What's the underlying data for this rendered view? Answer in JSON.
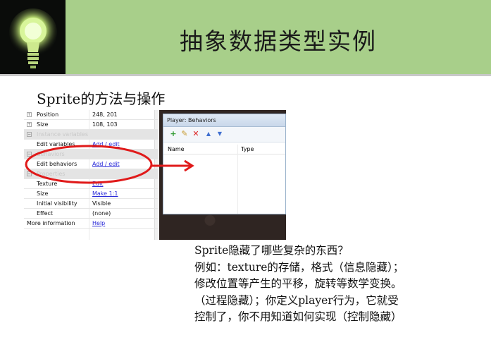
{
  "slide": {
    "title": "抽象数据类型实例",
    "subtitle": "Sprite的方法与操作"
  },
  "properties_panel": {
    "rows": [
      {
        "name": "Position",
        "value": "248, 201",
        "expander": "+"
      },
      {
        "name": "Size",
        "value": "108, 103",
        "expander": "+"
      },
      {
        "name": "Instance variables",
        "value": "",
        "section": true,
        "expander": "−"
      },
      {
        "name": "Edit variables",
        "value": "Add / edit",
        "link": true
      },
      {
        "name": "Behaviors",
        "value": "",
        "section": true,
        "expander": "−"
      },
      {
        "name": "Edit behaviors",
        "value": "Add / edit",
        "link": true
      },
      {
        "name": "Properties",
        "value": "",
        "section": true,
        "expander": "−"
      },
      {
        "name": "Texture",
        "value": "Edit",
        "link": true
      },
      {
        "name": "Size",
        "value": "Make 1:1",
        "link": true
      },
      {
        "name": "Initial visibility",
        "value": "Visible"
      },
      {
        "name": "Effect",
        "value": "(none)"
      },
      {
        "name": "More information",
        "value": "Help",
        "link": true,
        "flush": true
      }
    ]
  },
  "behaviors_dialog": {
    "title": "Player: Behaviors",
    "columns": [
      "Name",
      "Type"
    ],
    "toolbar_icons": [
      "add-icon",
      "edit-icon",
      "delete-icon",
      "move-up-icon",
      "move-down-icon"
    ]
  },
  "body_text": {
    "lines": [
      "Sprite隐藏了哪些复杂的东西？",
      "例如：texture的存储，格式（信息隐藏）；",
      "修改位置等产生的平移，旋转等数学变换。",
      "（过程隐藏）；你定义player行为，它就受",
      "控制了，你不用知道如何实现（控制隐藏）"
    ]
  },
  "colors": {
    "header_green": "#a8cf8a",
    "header_dark": "#0a0c0a",
    "annotation_red": "#e01a1a",
    "link_blue": "#2a2ad8"
  }
}
